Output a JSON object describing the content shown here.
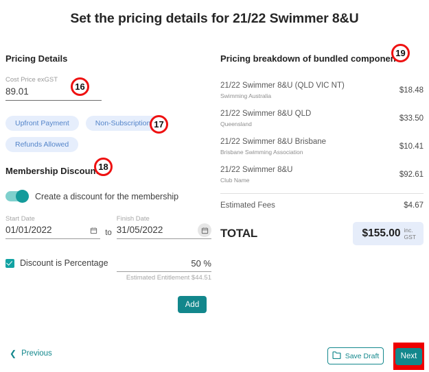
{
  "title": "Set the pricing details for 21/22 Swimmer 8&U",
  "left": {
    "section_title": "Pricing Details",
    "cost_price": {
      "label": "Cost Price exGST",
      "value": "89.01"
    },
    "chips": [
      {
        "label": "Upfront Payment"
      },
      {
        "label": "Non-Subscription"
      },
      {
        "label": "Refunds Allowed"
      }
    ],
    "membership_discounts": {
      "section_title": "Membership Discounts",
      "toggle_label": "Create a discount for the membership",
      "toggle_state": "on",
      "start_date": {
        "label": "Start Date",
        "value": "01/01/2022"
      },
      "to_word": "to",
      "finish_date": {
        "label": "Finish Date",
        "value": "31/05/2022"
      },
      "percentage_checkbox_label": "Discount is Percentage",
      "percentage_checked": "true",
      "percentage_value": "50 %",
      "percentage_hint": "Estimated Entitlement $44.51",
      "add_label": "Add"
    }
  },
  "right": {
    "section_title": "Pricing breakdown of bundled components",
    "items": [
      {
        "name": "21/22 Swimmer 8&U (QLD VIC NT)",
        "org": "Swimming Australia",
        "price": "$18.48"
      },
      {
        "name": "21/22 Swimmer 8&U QLD",
        "org": "Queensland",
        "price": "$33.50"
      },
      {
        "name": "21/22 Swimmer 8&U Brisbane",
        "org": "Brisbane Swimming Association",
        "price": "$10.41"
      },
      {
        "name": "21/22 Swimmer 8&U",
        "org": "Club Name",
        "price": "$92.61"
      }
    ],
    "fees_label": "Estimated Fees",
    "fees_value": "$4.67",
    "total_label": "TOTAL",
    "total_amount": "$155.00",
    "total_gst_line1": "inc.",
    "total_gst_line2": "GST"
  },
  "footer": {
    "previous_label": "Previous",
    "save_draft_label": "Save Draft",
    "next_label": "Next"
  },
  "markers": {
    "m16": "16",
    "m17": "17",
    "m18": "18",
    "m19": "19"
  },
  "colors": {
    "teal": "#12878c",
    "toggle_teal": "#149b9b",
    "chip_bg": "#e6eefc",
    "chip_text": "#5384c9",
    "badge_bg": "#e6edfa",
    "marker_red": "#ee1111"
  }
}
